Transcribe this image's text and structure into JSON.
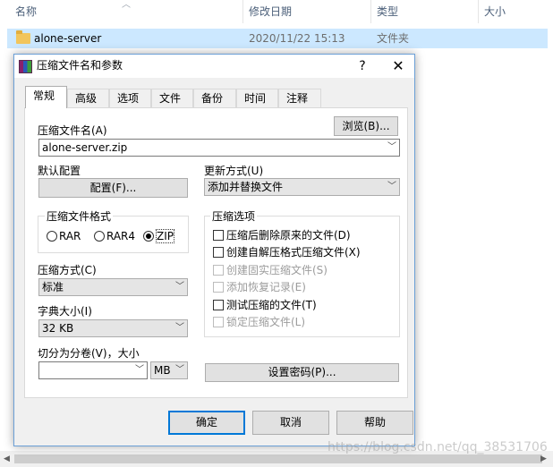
{
  "explorer": {
    "columns": {
      "name": "名称",
      "date": "修改日期",
      "type": "类型",
      "size": "大小"
    },
    "rows": [
      {
        "name": "alone-server",
        "date": "2020/11/22 15:13",
        "type": "文件夹"
      }
    ]
  },
  "dialog": {
    "title": "压缩文件名和参数",
    "help": "?",
    "close": "✕",
    "tabs": [
      "常规",
      "高级",
      "选项",
      "文件",
      "备份",
      "时间",
      "注释"
    ],
    "archive_name_label": "压缩文件名(A)",
    "archive_name_value": "alone-server.zip",
    "browse_button": "浏览(B)...",
    "default_profile_label": "默认配置",
    "profiles_button": "配置(F)...",
    "update_mode_label": "更新方式(U)",
    "update_mode_value": "添加并替换文件",
    "format_group": {
      "title": "压缩文件格式",
      "options": [
        {
          "label": "RAR",
          "selected": false
        },
        {
          "label": "RAR4",
          "selected": false
        },
        {
          "label": "ZIP",
          "selected": true
        }
      ]
    },
    "method_label": "压缩方式(C)",
    "method_value": "标准",
    "dict_label": "字典大小(I)",
    "dict_value": "32 KB",
    "split_label": "切分为分卷(V)，大小",
    "split_value": "",
    "split_unit": "MB",
    "options_group": {
      "title": "压缩选项",
      "items": [
        {
          "label": "压缩后删除原来的文件(D)",
          "checked": false,
          "enabled": true
        },
        {
          "label": "创建自解压格式压缩文件(X)",
          "checked": false,
          "enabled": true
        },
        {
          "label": "创建固实压缩文件(S)",
          "checked": false,
          "enabled": false
        },
        {
          "label": "添加恢复记录(E)",
          "checked": false,
          "enabled": false
        },
        {
          "label": "测试压缩的文件(T)",
          "checked": false,
          "enabled": true
        },
        {
          "label": "锁定压缩文件(L)",
          "checked": false,
          "enabled": false
        }
      ]
    },
    "password_button": "设置密码(P)...",
    "ok_button": "确定",
    "cancel_button": "取消",
    "help_button": "帮助"
  },
  "watermark": "https://blog.csdn.net/qq_38531706"
}
